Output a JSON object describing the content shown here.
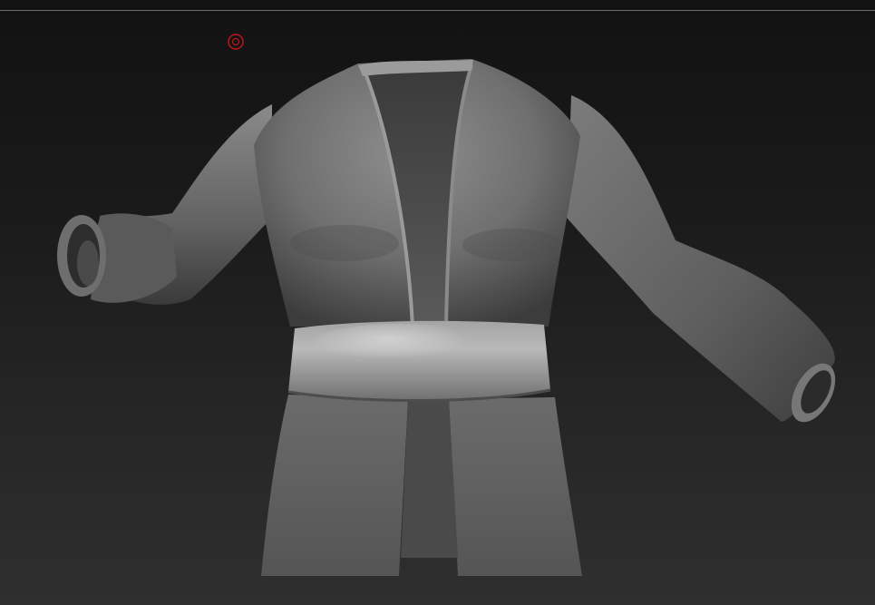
{
  "viewport": {
    "background_top": "#121212",
    "background_bottom": "#2f2f2f",
    "separator_color": "#6a6a6a"
  },
  "cursor": {
    "icon": "brush-cursor-icon",
    "color": "#c0161b"
  },
  "model": {
    "subject": "sculpted-jacket-with-belt",
    "base_color": "#7c7c7c",
    "highlight_color": "#bdbdbd",
    "shadow_color": "#2a2a2a"
  }
}
